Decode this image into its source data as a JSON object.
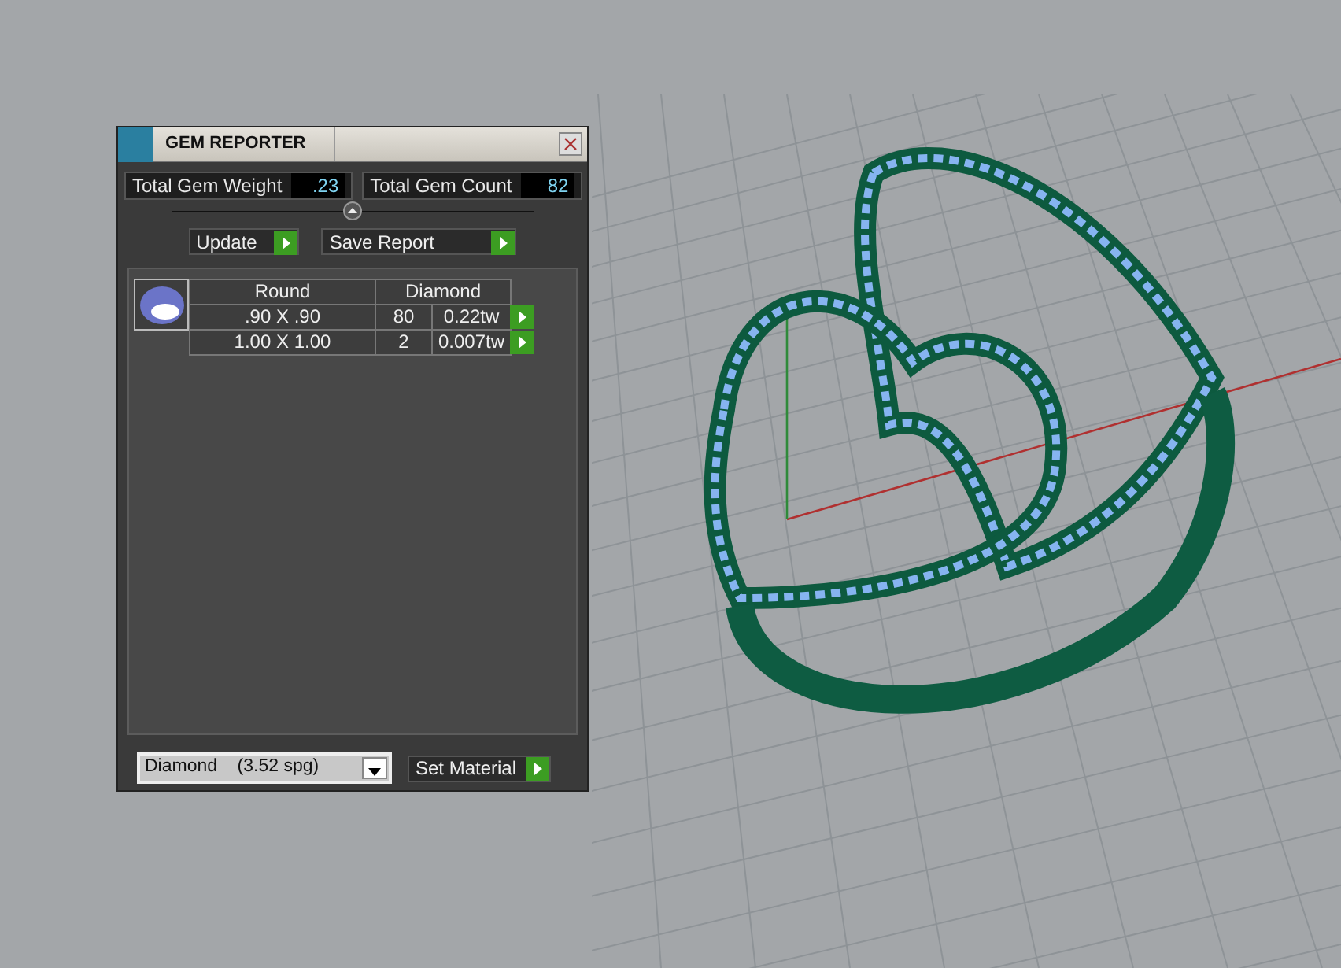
{
  "panel": {
    "title": "GEM REPORTER",
    "totals": [
      {
        "label": "Total Gem Weight",
        "value": ".23"
      },
      {
        "label": "Total Gem Count",
        "value": "82"
      }
    ],
    "buttons": [
      {
        "label": "Update"
      },
      {
        "label": "Save Report"
      }
    ],
    "table": {
      "columns": [
        "Round",
        "Diamond"
      ],
      "rows": [
        [
          ".90 X .90",
          "80",
          "0.22tw"
        ],
        [
          "1.00 X 1.00",
          "2",
          "0.007tw"
        ]
      ]
    },
    "material": {
      "value": "Diamond    (3.52 spg)"
    },
    "set_button": {
      "label": "Set Material"
    }
  }
}
